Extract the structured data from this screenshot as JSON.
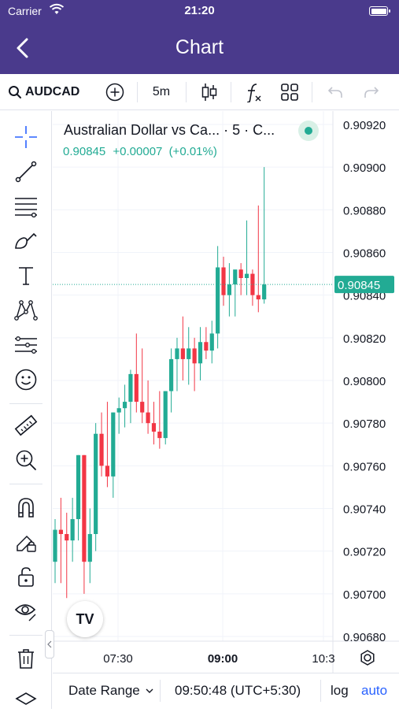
{
  "status_bar": {
    "carrier": "Carrier",
    "time": "21:20"
  },
  "nav": {
    "title": "Chart"
  },
  "toolbar": {
    "symbol": "AUDCAD",
    "interval": "5m",
    "icons": [
      "search-icon",
      "add-symbol-icon",
      "candles-icon",
      "indicators-icon",
      "layouts-icon",
      "undo-icon",
      "redo-icon"
    ]
  },
  "drawing_tools": [
    "crosshair-icon",
    "trend-line-icon",
    "fib-retracement-icon",
    "brush-icon",
    "text-icon",
    "pattern-icon",
    "prediction-icon",
    "emoji-icon",
    "ruler-icon",
    "zoom-in-icon",
    "magnet-icon",
    "lock-drawing-icon",
    "unlock-icon",
    "eye-icon",
    "trash-icon",
    "layers-icon"
  ],
  "legend": {
    "title": "Australian Dollar vs Ca... · 5 · C...",
    "price": "0.90845",
    "change": "+0.00007",
    "change_pct": "(+0.01%)"
  },
  "price_scale": {
    "labels": [
      "0.90920",
      "0.90900",
      "0.90880",
      "0.90860",
      "0.90840",
      "0.90820",
      "0.90800",
      "0.90780",
      "0.90760",
      "0.90740",
      "0.90720",
      "0.90700",
      "0.90680"
    ],
    "last_price_label": "0.90845"
  },
  "time_scale": {
    "labels": [
      "07:30",
      "09:00",
      "10:3"
    ]
  },
  "bottom_bar": {
    "date_range": "Date Range",
    "clock": "09:50:48 (UTC+5:30)",
    "log": "log",
    "auto": "auto"
  },
  "branding": {
    "logo_text": "TV"
  },
  "colors": {
    "header": "#4a3a8c",
    "up": "#22ab94",
    "down": "#f23645",
    "accent": "#2962ff"
  },
  "chart_data": {
    "type": "candlestick",
    "interval": "5m",
    "ylim": [
      0.90675,
      0.90925
    ],
    "x_ticks": [
      "07:30",
      "09:00",
      "10:3"
    ],
    "candles": [
      {
        "o": 0.90715,
        "h": 0.90735,
        "l": 0.90705,
        "c": 0.9073
      },
      {
        "o": 0.9073,
        "h": 0.90745,
        "l": 0.90705,
        "c": 0.90728
      },
      {
        "o": 0.90728,
        "h": 0.90738,
        "l": 0.90698,
        "c": 0.90725
      },
      {
        "o": 0.90725,
        "h": 0.90745,
        "l": 0.90715,
        "c": 0.90735
      },
      {
        "o": 0.90735,
        "h": 0.90765,
        "l": 0.90725,
        "c": 0.90765
      },
      {
        "o": 0.90765,
        "h": 0.90765,
        "l": 0.907,
        "c": 0.90715
      },
      {
        "o": 0.90715,
        "h": 0.9074,
        "l": 0.90705,
        "c": 0.90728
      },
      {
        "o": 0.90728,
        "h": 0.9078,
        "l": 0.9072,
        "c": 0.90775
      },
      {
        "o": 0.90775,
        "h": 0.90785,
        "l": 0.90755,
        "c": 0.9076
      },
      {
        "o": 0.9076,
        "h": 0.9079,
        "l": 0.9075,
        "c": 0.90755
      },
      {
        "o": 0.90755,
        "h": 0.90785,
        "l": 0.90745,
        "c": 0.90785
      },
      {
        "o": 0.90785,
        "h": 0.90792,
        "l": 0.90775,
        "c": 0.90787
      },
      {
        "o": 0.90787,
        "h": 0.90798,
        "l": 0.90778,
        "c": 0.9079
      },
      {
        "o": 0.9079,
        "h": 0.90805,
        "l": 0.9078,
        "c": 0.90803
      },
      {
        "o": 0.90803,
        "h": 0.90822,
        "l": 0.90785,
        "c": 0.9079
      },
      {
        "o": 0.9079,
        "h": 0.90815,
        "l": 0.9078,
        "c": 0.90785
      },
      {
        "o": 0.90785,
        "h": 0.908,
        "l": 0.90775,
        "c": 0.9078
      },
      {
        "o": 0.9078,
        "h": 0.9079,
        "l": 0.9077,
        "c": 0.90776
      },
      {
        "o": 0.90776,
        "h": 0.90795,
        "l": 0.90768,
        "c": 0.90773
      },
      {
        "o": 0.90773,
        "h": 0.90795,
        "l": 0.9077,
        "c": 0.90795
      },
      {
        "o": 0.90795,
        "h": 0.90815,
        "l": 0.90785,
        "c": 0.9081
      },
      {
        "o": 0.9081,
        "h": 0.9082,
        "l": 0.90795,
        "c": 0.90815
      },
      {
        "o": 0.90815,
        "h": 0.9083,
        "l": 0.908,
        "c": 0.9081
      },
      {
        "o": 0.9081,
        "h": 0.90825,
        "l": 0.90798,
        "c": 0.90815
      },
      {
        "o": 0.90815,
        "h": 0.9082,
        "l": 0.90795,
        "c": 0.90808
      },
      {
        "o": 0.90808,
        "h": 0.90825,
        "l": 0.908,
        "c": 0.90818
      },
      {
        "o": 0.90818,
        "h": 0.90825,
        "l": 0.9081,
        "c": 0.90814
      },
      {
        "o": 0.90814,
        "h": 0.90828,
        "l": 0.90808,
        "c": 0.90822
      },
      {
        "o": 0.90822,
        "h": 0.90863,
        "l": 0.90815,
        "c": 0.90853
      },
      {
        "o": 0.90853,
        "h": 0.90858,
        "l": 0.90835,
        "c": 0.9084
      },
      {
        "o": 0.9084,
        "h": 0.90855,
        "l": 0.9083,
        "c": 0.90845
      },
      {
        "o": 0.90845,
        "h": 0.9085,
        "l": 0.9083,
        "c": 0.90852
      },
      {
        "o": 0.90852,
        "h": 0.90855,
        "l": 0.9084,
        "c": 0.90848
      },
      {
        "o": 0.90848,
        "h": 0.90875,
        "l": 0.9084,
        "c": 0.9085
      },
      {
        "o": 0.9085,
        "h": 0.90852,
        "l": 0.90835,
        "c": 0.9084
      },
      {
        "o": 0.9084,
        "h": 0.90882,
        "l": 0.90832,
        "c": 0.90838
      },
      {
        "o": 0.90838,
        "h": 0.909,
        "l": 0.90836,
        "c": 0.90845
      }
    ]
  }
}
